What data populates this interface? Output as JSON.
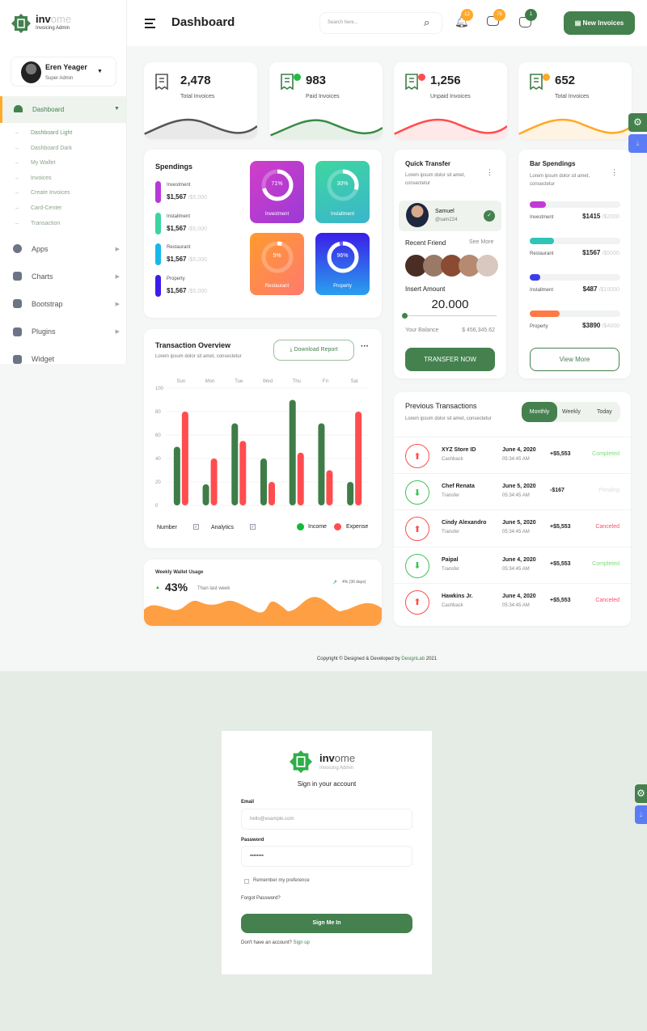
{
  "brand": {
    "name_dark": "inv",
    "name_light": "ome",
    "tagline": "Invoicing Admin"
  },
  "user": {
    "name": "Eren Yeager",
    "role": "Super Admin"
  },
  "sidebar": {
    "dashboard": "Dashboard",
    "sub_items": [
      "Dashboard Light",
      "Dashboard Dark",
      "My Wallet",
      "Invoices",
      "Create Invoices",
      "Card-Center",
      "Transaction"
    ],
    "items": [
      {
        "label": "Apps",
        "icon": "info-icon"
      },
      {
        "label": "Charts",
        "icon": "chart-icon"
      },
      {
        "label": "Bootstrap",
        "icon": "bootstrap-icon"
      },
      {
        "label": "Plugins",
        "icon": "heart-icon"
      },
      {
        "label": "Widget",
        "icon": "user-check-icon"
      }
    ]
  },
  "header": {
    "title": "Dashboard",
    "search_placeholder": "Search here...",
    "notifications": "12",
    "messages": "76",
    "cart": "1",
    "new_invoice": "New Invoices"
  },
  "stats": [
    {
      "value": "2,478",
      "label": "Total Invoices",
      "color": "#555555",
      "dot": ""
    },
    {
      "value": "983",
      "label": "Paid Invoices",
      "color": "#3a8a45",
      "dot": "#22bb44"
    },
    {
      "value": "1,256",
      "label": "Unpaid Invoices",
      "color": "#ff4d4f",
      "dot": "#ff4d4f"
    },
    {
      "value": "652",
      "label": "Total Invoices",
      "color": "#ffa928",
      "dot": "#ffa928"
    }
  ],
  "spendings": {
    "title": "Spendings",
    "items": [
      {
        "label": "Investment",
        "value": "$1,567",
        "total": "/$5,000",
        "color": "#b83ad6"
      },
      {
        "label": "Installment",
        "value": "$1,567",
        "total": "/$5,000",
        "color": "#3ed3a0"
      },
      {
        "label": "Restaurant",
        "value": "$1,567",
        "total": "/$5,000",
        "color": "#1ab7ea"
      },
      {
        "label": "Property",
        "value": "$1,567",
        "total": "/$5,000",
        "color": "#3a1ee8"
      }
    ],
    "tiles": [
      {
        "label": "Investment",
        "percent": 71
      },
      {
        "label": "Installment",
        "percent": 30
      },
      {
        "label": "Restaurant",
        "percent": 5
      },
      {
        "label": "Property",
        "percent": 96
      }
    ]
  },
  "quick_transfer": {
    "title": "Quick Transfer",
    "subtitle": "Lorem ipsum dolor sit amet, consectetur",
    "contact_name": "Samuel",
    "contact_handle": "@sam224",
    "recent": "Recent Friend",
    "see_more": "See More",
    "insert_amount": "Insert Amount",
    "amount": "20.000",
    "balance_label": "Your Balance",
    "balance": "$ 456,345.62",
    "button": "TRANSFER NOW"
  },
  "bar_spendings": {
    "title": "Bar Spendings",
    "subtitle": "Lorem ipsum dolor sit amet, consectetur",
    "items": [
      {
        "label": "Investment",
        "value": "$1415",
        "total": "/$2000",
        "fraction": 0.18,
        "color": "#c23ad6"
      },
      {
        "label": "Restaurant",
        "value": "$1567",
        "total": "/$5000",
        "fraction": 0.27,
        "color": "#2ec4b6"
      },
      {
        "label": "Installment",
        "value": "$487",
        "total": "/$10000",
        "fraction": 0.12,
        "color": "#3a3ee8"
      },
      {
        "label": "Property",
        "value": "$3890",
        "total": "/$4000",
        "fraction": 0.33,
        "color": "#ff7a45"
      }
    ],
    "button": "View More"
  },
  "transaction_overview": {
    "title": "Transaction Overview",
    "subtitle": "Lorem ipsum dolor sit amet, consectetur",
    "download": "Download Report",
    "toggle_number": "Number",
    "toggle_analytics": "Analytics"
  },
  "chart_data": {
    "type": "bar",
    "categories": [
      "Sun",
      "Mon",
      "Tue",
      "Wed",
      "Thu",
      "Fri",
      "Sat"
    ],
    "series": [
      {
        "name": "Income",
        "color": "#3f7d48",
        "values": [
          50,
          18,
          70,
          40,
          90,
          70,
          20
        ]
      },
      {
        "name": "Expense",
        "color": "#ff4d4f",
        "values": [
          80,
          40,
          55,
          20,
          45,
          30,
          80
        ]
      }
    ],
    "yticks": [
      0,
      20,
      40,
      60,
      80,
      100
    ],
    "ylim": [
      0,
      100
    ],
    "legend": "bottom-right",
    "grid": true
  },
  "wallet": {
    "title": "Weekly Wallet Usage",
    "percent": "43%",
    "compare": "Than last week",
    "trend": "4% (30 days)"
  },
  "transactions": {
    "title": "Previous Transactions",
    "subtitle": "Lorem ipsum dolor sit amet, consectetur",
    "tabs": [
      "Monthly",
      "Weekly",
      "Today"
    ],
    "rows": [
      {
        "name": "XYZ Store ID",
        "type": "Cashback",
        "date": "June 4, 2020",
        "time": "05:34:45 AM",
        "amount": "+$5,553",
        "status": "Completed",
        "dir": "up"
      },
      {
        "name": "Chef Renata",
        "type": "Transfer",
        "date": "June 5, 2020",
        "time": "05:34:45 AM",
        "amount": "-$167",
        "status": "Pending",
        "dir": "down"
      },
      {
        "name": "Cindy Alexandro",
        "type": "Transfer",
        "date": "June 5, 2020",
        "time": "05:34:45 AM",
        "amount": "+$5,553",
        "status": "Canceled",
        "dir": "up"
      },
      {
        "name": "Paipal",
        "type": "Transfer",
        "date": "June 4, 2020",
        "time": "05:34:45 AM",
        "amount": "+$5,553",
        "status": "Completed",
        "dir": "down"
      },
      {
        "name": "Hawkins Jr.",
        "type": "Cashback",
        "date": "June 4, 2020",
        "time": "05:34:45 AM",
        "amount": "+$5,553",
        "status": "Canceled",
        "dir": "up"
      }
    ]
  },
  "footer": {
    "text": "Copyright © Designed & Developed by ",
    "link": "DesignLab",
    "year": " 2021"
  },
  "login": {
    "heading": "Sign in your account",
    "email_label": "Email",
    "email_placeholder": "hello@example.com",
    "password_label": "Password",
    "password_value": "••••••••",
    "remember": "Remember my preference",
    "forgot": "Forgot Password?",
    "button": "Sign Me In",
    "no_account": "Don't have an account?",
    "signup": "Sign up"
  }
}
